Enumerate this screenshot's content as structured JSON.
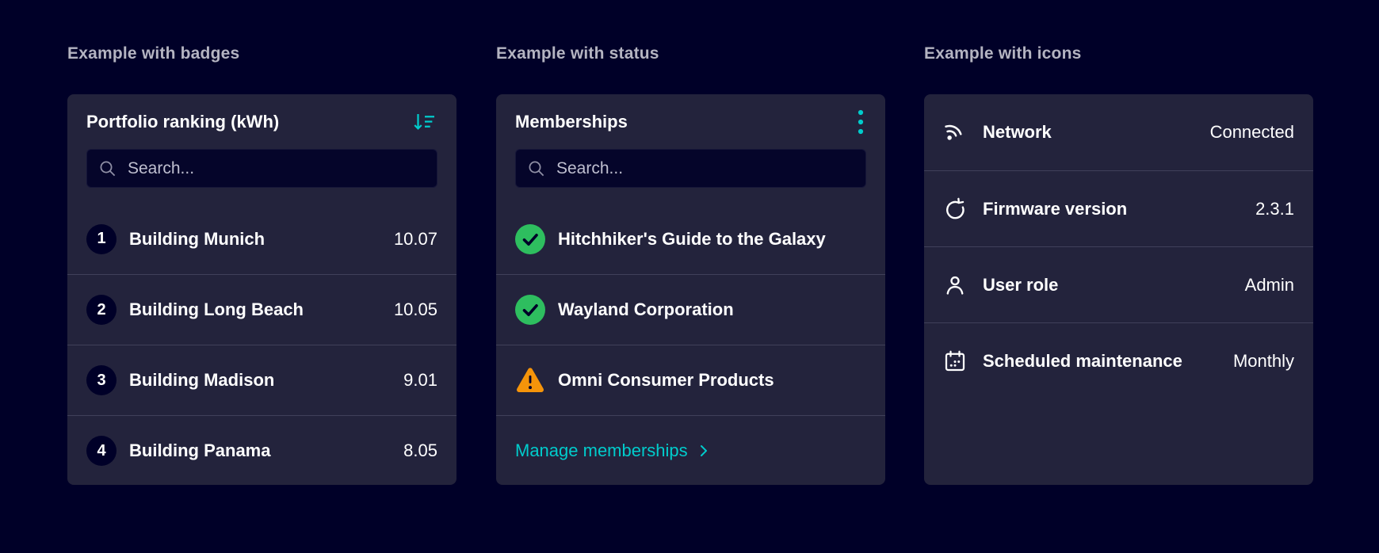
{
  "colors": {
    "page-bg": "#000028",
    "card-bg": "#23233C",
    "accent": "#00CCCC",
    "success": "#2EBE5F",
    "warning": "#F5940A",
    "badge-bg": "#000028",
    "separator": "#40405A",
    "heading-text": "#B4B4C1",
    "text": "#FFFFFF"
  },
  "sections": {
    "badges": {
      "heading": "Example with badges",
      "card": {
        "title": "Portfolio ranking (kWh)",
        "header_icon": "sort-descending-icon",
        "search": {
          "placeholder": "Search..."
        },
        "items": [
          {
            "rank": "1",
            "label": "Building Munich",
            "value": "10.07"
          },
          {
            "rank": "2",
            "label": "Building Long Beach",
            "value": "10.05"
          },
          {
            "rank": "3",
            "label": "Building Madison",
            "value": "9.01"
          },
          {
            "rank": "4",
            "label": "Building Panama",
            "value": "8.05"
          }
        ]
      }
    },
    "status": {
      "heading": "Example with status",
      "card": {
        "title": "Memberships",
        "header_icon": "kebab-menu-icon",
        "search": {
          "placeholder": "Search..."
        },
        "items": [
          {
            "status": "success",
            "label": "Hitchhiker's Guide to the Galaxy"
          },
          {
            "status": "success",
            "label": "Wayland Corporation"
          },
          {
            "status": "warning",
            "label": "Omni Consumer Products"
          }
        ],
        "footer_link": {
          "label": "Manage memberships"
        }
      }
    },
    "icons": {
      "heading": "Example with icons",
      "card": {
        "items": [
          {
            "icon": "network-icon",
            "label": "Network",
            "value": "Connected"
          },
          {
            "icon": "reset-icon",
            "label": "Firmware version",
            "value": "2.3.1"
          },
          {
            "icon": "user-icon",
            "label": "User role",
            "value": "Admin"
          },
          {
            "icon": "calendar-icon",
            "label": "Scheduled maintenance",
            "value": "Monthly"
          }
        ]
      }
    }
  }
}
